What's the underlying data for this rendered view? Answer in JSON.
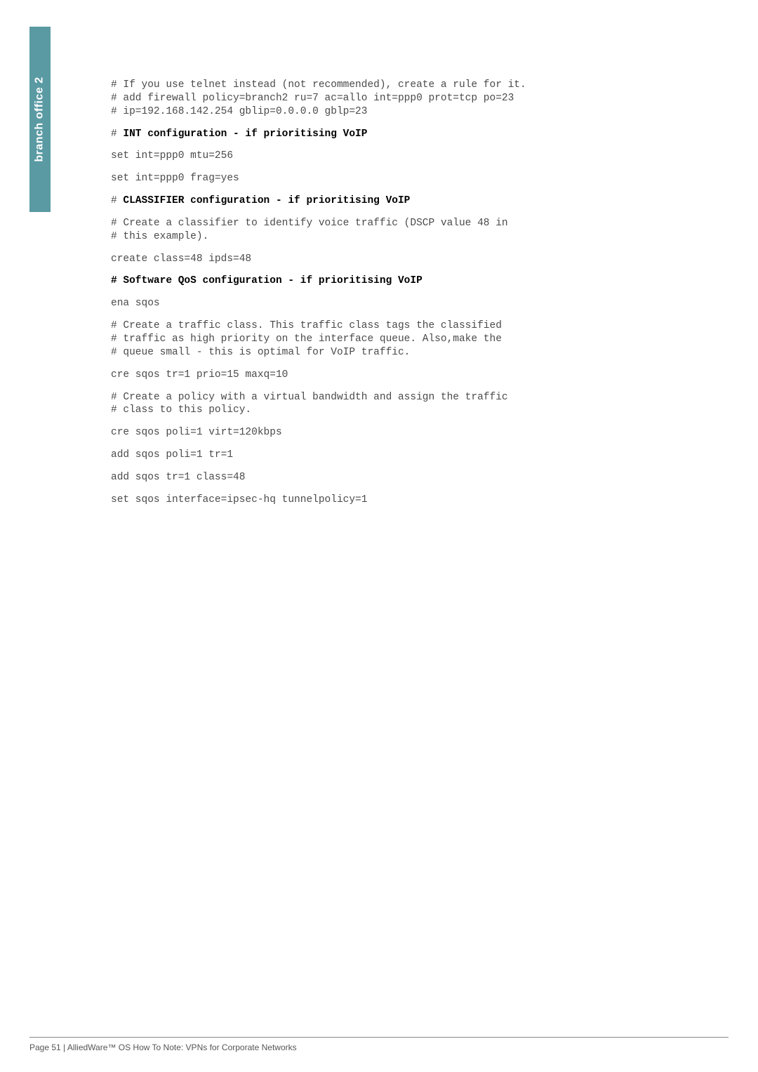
{
  "sidebar": {
    "label": "branch office 2"
  },
  "lines": [
    {
      "text": "# If you use telnet instead (not recommended), create a rule for it.",
      "bold": false
    },
    {
      "text": "# add firewall policy=branch2 ru=7 ac=allo int=ppp0 prot=tcp po=23",
      "bold": false
    },
    {
      "text": "# ip=192.168.142.254 gblip=0.0.0.0 gblp=23",
      "bold": false
    },
    {
      "prefix": "# ",
      "boldPart": "INT configuration - if prioritising VoIP"
    },
    {
      "text": "set int=ppp0 mtu=256",
      "bold": false
    },
    {
      "text": "set int=ppp0 frag=yes",
      "bold": false
    },
    {
      "prefix": "# ",
      "boldPart": "CLASSIFIER configuration - if prioritising VoIP"
    },
    {
      "text": "# Create a classifier to identify voice traffic (DSCP value 48 in",
      "bold": false
    },
    {
      "text": "# this example).",
      "bold": false
    },
    {
      "text": "create class=48 ipds=48",
      "bold": false
    },
    {
      "text": "# Software QoS configuration - if prioritising VoIP",
      "bold": true
    },
    {
      "text": "ena sqos",
      "bold": false
    },
    {
      "text": "# Create a traffic class. This traffic class tags the classified",
      "bold": false
    },
    {
      "text": "# traffic as high priority on the interface queue. Also,make the",
      "bold": false
    },
    {
      "text": "# queue small - this is optimal for VoIP traffic.",
      "bold": false
    },
    {
      "text": "cre sqos tr=1 prio=15 maxq=10",
      "bold": false
    },
    {
      "text": "# Create a policy with a virtual bandwidth and assign the traffic",
      "bold": false
    },
    {
      "text": "# class to this policy.",
      "bold": false
    },
    {
      "text": "cre sqos poli=1 virt=120kbps",
      "bold": false
    },
    {
      "text": "add sqos poli=1 tr=1",
      "bold": false
    },
    {
      "text": "add sqos tr=1 class=48",
      "bold": false
    },
    {
      "text": "set sqos interface=ipsec-hq tunnelpolicy=1",
      "bold": false
    }
  ],
  "groups": [
    [
      0,
      1,
      2
    ],
    [
      3
    ],
    [
      4
    ],
    [
      5
    ],
    [
      6
    ],
    [
      7,
      8
    ],
    [
      9
    ],
    [
      10
    ],
    [
      11
    ],
    [
      12,
      13,
      14
    ],
    [
      15
    ],
    [
      16,
      17
    ],
    [
      18
    ],
    [
      19
    ],
    [
      20
    ],
    [
      21
    ]
  ],
  "footer": {
    "text": "Page 51 | AlliedWare™ OS How To Note: VPNs for Corporate Networks"
  }
}
